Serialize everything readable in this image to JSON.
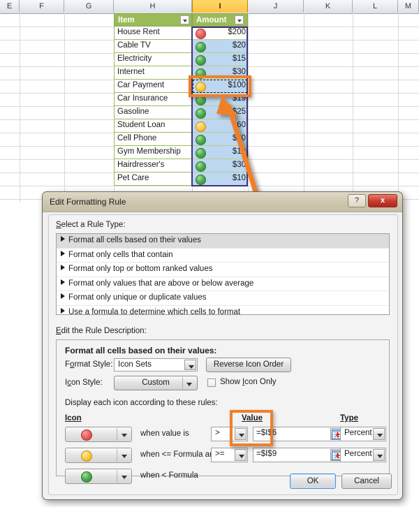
{
  "spreadsheet": {
    "column_headers": [
      "E",
      "F",
      "G",
      "H",
      "I",
      "J",
      "K",
      "L",
      "M"
    ],
    "selected_column": "I",
    "table": {
      "headers": {
        "item": "Item",
        "amount": "Amount"
      },
      "rows": [
        {
          "item": "House Rent",
          "amount": "$200",
          "icon": "red"
        },
        {
          "item": "Cable TV",
          "amount": "$20",
          "icon": "green"
        },
        {
          "item": "Electricity",
          "amount": "$15",
          "icon": "green"
        },
        {
          "item": "Internet",
          "amount": "$30",
          "icon": "green"
        },
        {
          "item": "Car Payment",
          "amount": "$100",
          "icon": "yellow"
        },
        {
          "item": "Car Insurance",
          "amount": "$19",
          "icon": "green"
        },
        {
          "item": "Gasoline",
          "amount": "$25",
          "icon": "green"
        },
        {
          "item": "Student Loan",
          "amount": "$60",
          "icon": "yellow"
        },
        {
          "item": "Cell Phone",
          "amount": "$20",
          "icon": "green"
        },
        {
          "item": "Gym Membership",
          "amount": "$10",
          "icon": "green"
        },
        {
          "item": "Hairdresser's",
          "amount": "$30",
          "icon": "green"
        },
        {
          "item": "Pet Care",
          "amount": "$10",
          "icon": "green"
        }
      ]
    }
  },
  "dialog": {
    "title": "Edit Formatting Rule",
    "help_label": "?",
    "close_label": "x",
    "select_rule_label": "Select a Rule Type:",
    "rule_types": [
      "Format all cells based on their values",
      "Format only cells that contain",
      "Format only top or bottom ranked values",
      "Format only values that are above or below average",
      "Format only unique or duplicate values",
      "Use a formula to determine which cells to format"
    ],
    "selected_rule_index": 0,
    "edit_description_label": "Edit the Rule Description:",
    "description_heading": "Format all cells based on their values:",
    "format_style_label": "Format Style:",
    "format_style_value": "Icon Sets",
    "reverse_icon_order_label": "Reverse Icon Order",
    "icon_style_label": "Icon Style:",
    "icon_style_value": "Custom",
    "show_icon_only_label": "Show Icon Only",
    "show_icon_only_checked": false,
    "display_rules_label": "Display each icon according to these rules:",
    "col_icon_label": "Icon",
    "col_value_label": "Value",
    "col_type_label": "Type",
    "icon_rules": [
      {
        "icon": "red",
        "condition": "when value is",
        "operator": ">",
        "value": "=$I$6",
        "type": "Percent"
      },
      {
        "icon": "yellow",
        "condition": "when <= Formula and",
        "operator": ">=",
        "value": "=$I$9",
        "type": "Percent"
      },
      {
        "icon": "green",
        "condition": "when < Formula",
        "operator": "",
        "value": "",
        "type": ""
      }
    ],
    "ok_label": "OK",
    "cancel_label": "Cancel"
  },
  "annotation": {
    "color": "#f07f2a",
    "arrow_from": "value-range-picker",
    "arrow_to": "car-payment-amount-cell"
  }
}
